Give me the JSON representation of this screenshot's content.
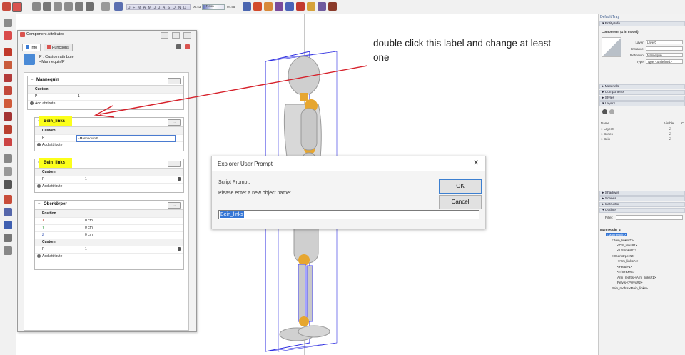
{
  "toolbar": {
    "date_strip": "J F M A M J J A S O N D",
    "time_am": "06:43",
    "time_noon": "Noon",
    "time_pm": "04:45"
  },
  "component_attributes": {
    "title": "Component Attributes",
    "tabs": [
      "Info",
      "Functions"
    ],
    "info_line1": "P : Custom attribute",
    "info_line2": "=Mannequin!P",
    "components": [
      {
        "name": "Mannequin",
        "rows": [
          {
            "type": "section",
            "key": "Custom"
          },
          {
            "type": "attr",
            "key": "P",
            "value": "1"
          },
          {
            "type": "add",
            "key": "Add attribute"
          }
        ]
      },
      {
        "name": "Bein_links",
        "highlighted": true,
        "rows": [
          {
            "type": "section",
            "key": "Custom"
          },
          {
            "type": "attr",
            "key": "P",
            "value": "=Mannequin!P",
            "editing": true
          },
          {
            "type": "add",
            "key": "Add attribute"
          }
        ]
      },
      {
        "name": "Bein_links",
        "highlighted": true,
        "rows": [
          {
            "type": "section",
            "key": "Custom"
          },
          {
            "type": "attr",
            "key": "P",
            "value": "1"
          },
          {
            "type": "add",
            "key": "Add attribute"
          }
        ]
      },
      {
        "name": "Oberkörper",
        "rows": [
          {
            "type": "section",
            "key": "Position"
          },
          {
            "type": "attr",
            "key": "X",
            "value": "0 cm"
          },
          {
            "type": "attr",
            "key": "Y",
            "value": "0 cm"
          },
          {
            "type": "attr",
            "key": "Z",
            "value": "0 cm"
          },
          {
            "type": "section",
            "key": "Custom"
          },
          {
            "type": "attr",
            "key": "P",
            "value": "1"
          },
          {
            "type": "add",
            "key": "Add attribute"
          }
        ]
      }
    ]
  },
  "annotation": {
    "text": "double click this label and change at least one",
    "color": "#d6202a"
  },
  "prompt": {
    "title": "Explorer User Prompt",
    "label": "Script Prompt:",
    "message": "Please enter a new object name:",
    "ok": "OK",
    "cancel": "Cancel",
    "value": "Bein_links",
    "close": "✕"
  },
  "tray": {
    "title": "Default Tray",
    "entity_info": {
      "header": "Entity Info",
      "subtitle": "Component (1 in model)",
      "layer_label": "Layer:",
      "layer_value": "Layer0",
      "instance_label": "Instance:",
      "instance_value": "",
      "definition_label": "Definition:",
      "definition_value": "Mannequin",
      "type_label": "Type:",
      "type_value": "Type: <undefined>"
    },
    "panels": [
      "Materials",
      "Components",
      "Styles",
      "Layers"
    ],
    "layers": {
      "col_name": "Name",
      "col_visible": "Visible",
      "col_color": "C",
      "items": [
        "Layer0",
        "Bones",
        "Bein"
      ]
    },
    "panels2": [
      "Shadows",
      "Scenes",
      "Instructor",
      "Outliner"
    ],
    "filter_label": "Filter:",
    "outliner": [
      "Mannequin_2",
      "<Mannequin>",
      "<Bein_links#1>",
      "<OS_links#1>",
      "<US-links#1>",
      "<Oberkörper#2>",
      "<Arm_links#4>",
      "<Head#1>",
      "<Thorax#3>",
      "Arm_rechts <Arm_links#1>",
      "Pelvis <Pelvis#2>",
      "Bein_rechts <Bein_links>"
    ]
  }
}
